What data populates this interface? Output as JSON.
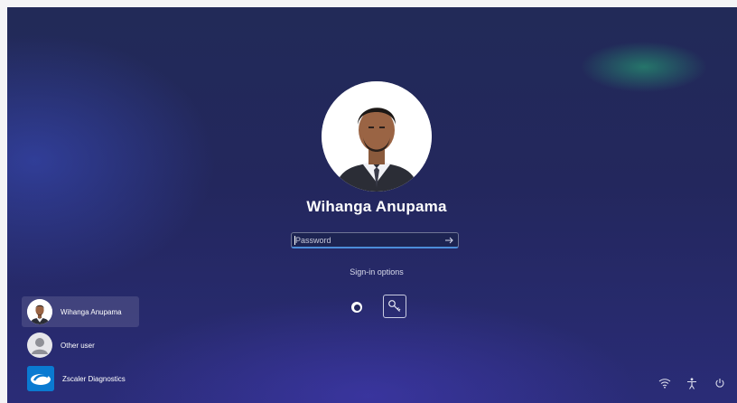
{
  "lock_screen": {
    "user_name": "Wihanga Anupama",
    "password": {
      "value": "",
      "placeholder": "Password"
    },
    "submit_icon": "arrow-right-icon",
    "sign_in_options_label": "Sign-in options",
    "options": [
      {
        "icon": "pin-icon",
        "selected": true
      },
      {
        "icon": "key-icon",
        "selected": false
      }
    ]
  },
  "user_list": [
    {
      "name": "Wihanga Anupama",
      "icon": "user-photo",
      "active": true
    },
    {
      "name": "Other user",
      "icon": "generic-user-icon",
      "active": false
    },
    {
      "name": "Zscaler Diagnostics",
      "icon": "zscaler-logo-icon",
      "active": false
    }
  ],
  "system_tray": [
    "wifi-icon",
    "accessibility-icon",
    "power-icon"
  ],
  "colors": {
    "background_top": "#222a58",
    "background_bottom": "#2a2c77",
    "accent": "#4c8dd9",
    "green_glow": "#28b478"
  }
}
